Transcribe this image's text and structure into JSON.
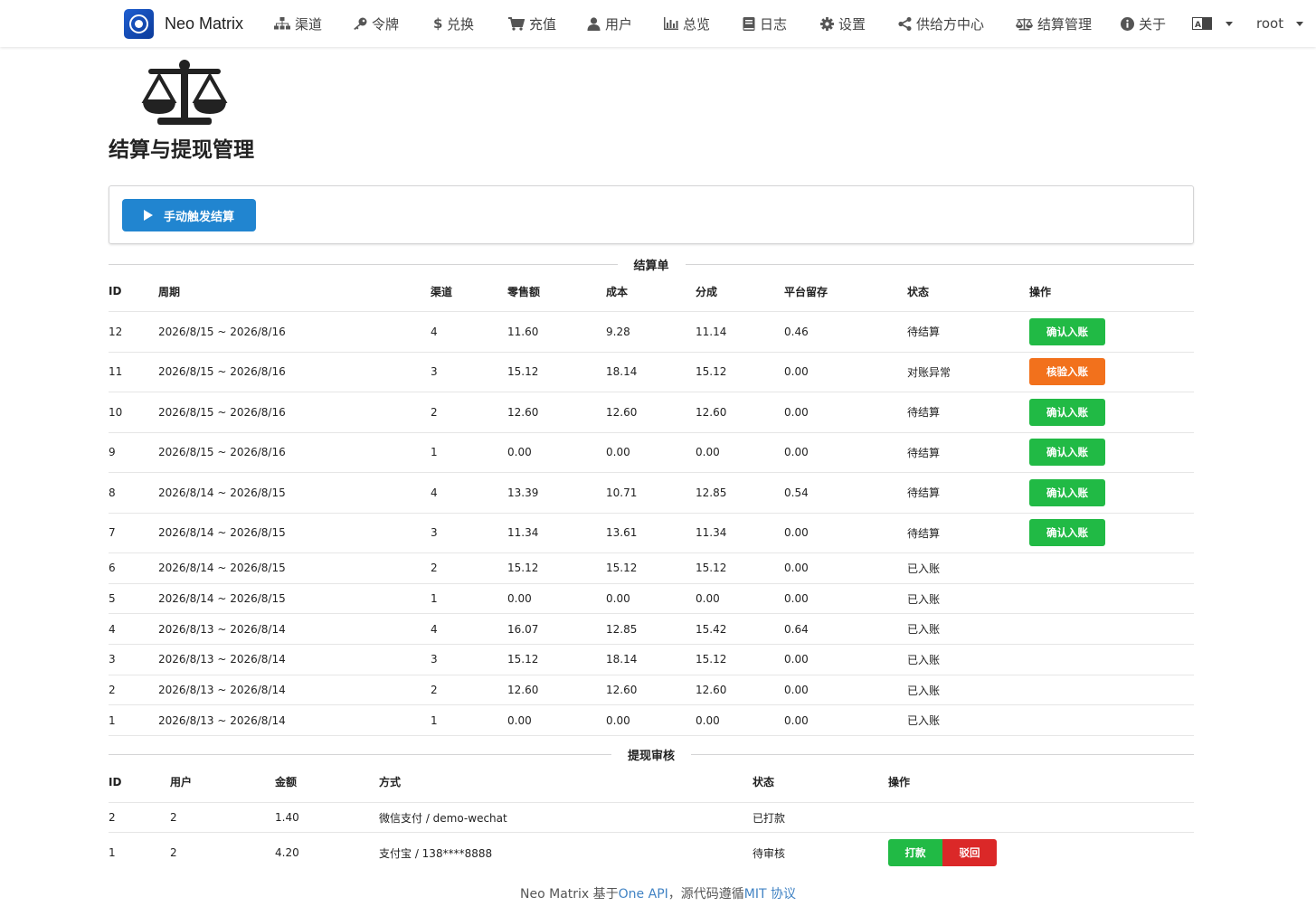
{
  "app": {
    "name": "Neo Matrix"
  },
  "nav": {
    "items": [
      {
        "label": "渠道",
        "icon": "sitemap-icon"
      },
      {
        "label": "令牌",
        "icon": "key-icon"
      },
      {
        "label": "兑换",
        "icon": "dollar-icon"
      },
      {
        "label": "充值",
        "icon": "cart-icon"
      },
      {
        "label": "用户",
        "icon": "user-icon"
      },
      {
        "label": "总览",
        "icon": "bar-chart-icon"
      },
      {
        "label": "日志",
        "icon": "book-icon"
      },
      {
        "label": "设置",
        "icon": "gear-icon"
      },
      {
        "label": "供给方中心",
        "icon": "share-icon"
      },
      {
        "label": "结算管理",
        "icon": "balance-scale-icon"
      },
      {
        "label": "关于",
        "icon": "info-circle-icon"
      }
    ],
    "language_icon": "language-icon",
    "user": "root"
  },
  "page": {
    "title": "结算与提现管理",
    "hero_icon": "balance-scale-icon",
    "trigger_button": "手动触发结算"
  },
  "settlements": {
    "section_title": "结算单",
    "columns": [
      "ID",
      "周期",
      "渠道",
      "零售额",
      "成本",
      "分成",
      "平台留存",
      "状态",
      "操作"
    ],
    "rows": [
      {
        "id": "12",
        "period": "2026/8/15 ~ 2026/8/16",
        "channel": "4",
        "retail": "11.60",
        "cost": "9.28",
        "share": "11.14",
        "retain": "0.46",
        "status": "待结算",
        "action": "确认入账",
        "action_color": "#21ba45"
      },
      {
        "id": "11",
        "period": "2026/8/15 ~ 2026/8/16",
        "channel": "3",
        "retail": "15.12",
        "cost": "18.14",
        "share": "15.12",
        "retain": "0.00",
        "status": "对账异常",
        "action": "核验入账",
        "action_color": "#f2711c"
      },
      {
        "id": "10",
        "period": "2026/8/15 ~ 2026/8/16",
        "channel": "2",
        "retail": "12.60",
        "cost": "12.60",
        "share": "12.60",
        "retain": "0.00",
        "status": "待结算",
        "action": "确认入账",
        "action_color": "#21ba45"
      },
      {
        "id": "9",
        "period": "2026/8/15 ~ 2026/8/16",
        "channel": "1",
        "retail": "0.00",
        "cost": "0.00",
        "share": "0.00",
        "retain": "0.00",
        "status": "待结算",
        "action": "确认入账",
        "action_color": "#21ba45"
      },
      {
        "id": "8",
        "period": "2026/8/14 ~ 2026/8/15",
        "channel": "4",
        "retail": "13.39",
        "cost": "10.71",
        "share": "12.85",
        "retain": "0.54",
        "status": "待结算",
        "action": "确认入账",
        "action_color": "#21ba45"
      },
      {
        "id": "7",
        "period": "2026/8/14 ~ 2026/8/15",
        "channel": "3",
        "retail": "11.34",
        "cost": "13.61",
        "share": "11.34",
        "retain": "0.00",
        "status": "待结算",
        "action": "确认入账",
        "action_color": "#21ba45"
      },
      {
        "id": "6",
        "period": "2026/8/14 ~ 2026/8/15",
        "channel": "2",
        "retail": "15.12",
        "cost": "15.12",
        "share": "15.12",
        "retain": "0.00",
        "status": "已入账",
        "action": ""
      },
      {
        "id": "5",
        "period": "2026/8/14 ~ 2026/8/15",
        "channel": "1",
        "retail": "0.00",
        "cost": "0.00",
        "share": "0.00",
        "retain": "0.00",
        "status": "已入账",
        "action": ""
      },
      {
        "id": "4",
        "period": "2026/8/13 ~ 2026/8/14",
        "channel": "4",
        "retail": "16.07",
        "cost": "12.85",
        "share": "15.42",
        "retain": "0.64",
        "status": "已入账",
        "action": ""
      },
      {
        "id": "3",
        "period": "2026/8/13 ~ 2026/8/14",
        "channel": "3",
        "retail": "15.12",
        "cost": "18.14",
        "share": "15.12",
        "retain": "0.00",
        "status": "已入账",
        "action": ""
      },
      {
        "id": "2",
        "period": "2026/8/13 ~ 2026/8/14",
        "channel": "2",
        "retail": "12.60",
        "cost": "12.60",
        "share": "12.60",
        "retain": "0.00",
        "status": "已入账",
        "action": ""
      },
      {
        "id": "1",
        "period": "2026/8/13 ~ 2026/8/14",
        "channel": "1",
        "retail": "0.00",
        "cost": "0.00",
        "share": "0.00",
        "retain": "0.00",
        "status": "已入账",
        "action": ""
      }
    ]
  },
  "withdrawals": {
    "section_title": "提现审核",
    "columns": [
      "ID",
      "用户",
      "金额",
      "方式",
      "状态",
      "操作"
    ],
    "rows": [
      {
        "id": "2",
        "user": "2",
        "amount": "1.40",
        "method": "微信支付 / demo-wechat",
        "status": "已打款",
        "actions": []
      },
      {
        "id": "1",
        "user": "2",
        "amount": "4.20",
        "method": "支付宝 / 138****8888",
        "status": "待审核",
        "actions": [
          "打款",
          "驳回"
        ]
      }
    ]
  },
  "footer": {
    "prefix": "Neo Matrix 基于",
    "link1": "One API",
    "middle": "，源代码遵循",
    "link2": "MIT 协议"
  }
}
